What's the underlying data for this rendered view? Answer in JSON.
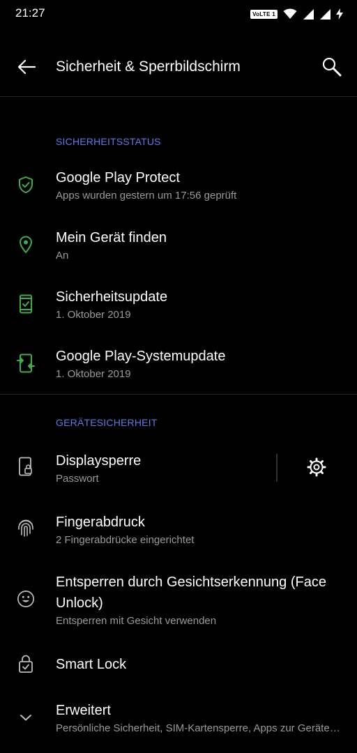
{
  "status_bar": {
    "time": "21:27",
    "volte_badge": "VoLTE 1",
    "icons": [
      "volte-icon",
      "wifi-icon",
      "signal-icon",
      "signal-icon",
      "charging-icon"
    ]
  },
  "app_bar": {
    "title": "Sicherheit & Sperrbildschirm",
    "back_icon": "arrow-back-icon",
    "search_icon": "search-icon"
  },
  "colors": {
    "background": "#000000",
    "accent": "#5f7ae6",
    "security_green": "#3fae46",
    "subtitle": "#9a9a9a"
  },
  "security_status": {
    "header": "SICHERHEITSSTATUS",
    "items": [
      {
        "title": "Google Play Protect",
        "subtitle": "Apps wurden gestern um 17:56 geprüft",
        "icon": "shield-check-icon"
      },
      {
        "title": "Mein Gerät finden",
        "subtitle": "An",
        "icon": "location-pin-icon"
      },
      {
        "title": "Sicherheitsupdate",
        "subtitle": "1. Oktober 2019",
        "icon": "phone-check-icon"
      },
      {
        "title": "Google Play-Systemupdate",
        "subtitle": "1. Oktober 2019",
        "icon": "phone-update-icon"
      }
    ]
  },
  "device_security": {
    "header": "GERÄTESICHERHEIT",
    "items": [
      {
        "title": "Displaysperre",
        "subtitle": "Passwort",
        "icon": "phone-lock-icon",
        "action_icon": "gear-icon"
      },
      {
        "title": "Fingerabdruck",
        "subtitle": "2 Fingerabdrücke eingerichtet",
        "icon": "fingerprint-icon"
      },
      {
        "title": "Entsperren durch Gesichtserkennung (Face Unlock)",
        "subtitle": "Entsperren mit Gesicht verwenden",
        "icon": "face-icon"
      },
      {
        "title": "Smart Lock",
        "subtitle": "",
        "icon": "lock-check-icon"
      },
      {
        "title": "Erweitert",
        "subtitle": "Persönliche Sicherheit, SIM-Kartensperre, Apps zur Geräteverwaltung",
        "icon": "chevron-down-icon"
      }
    ]
  }
}
